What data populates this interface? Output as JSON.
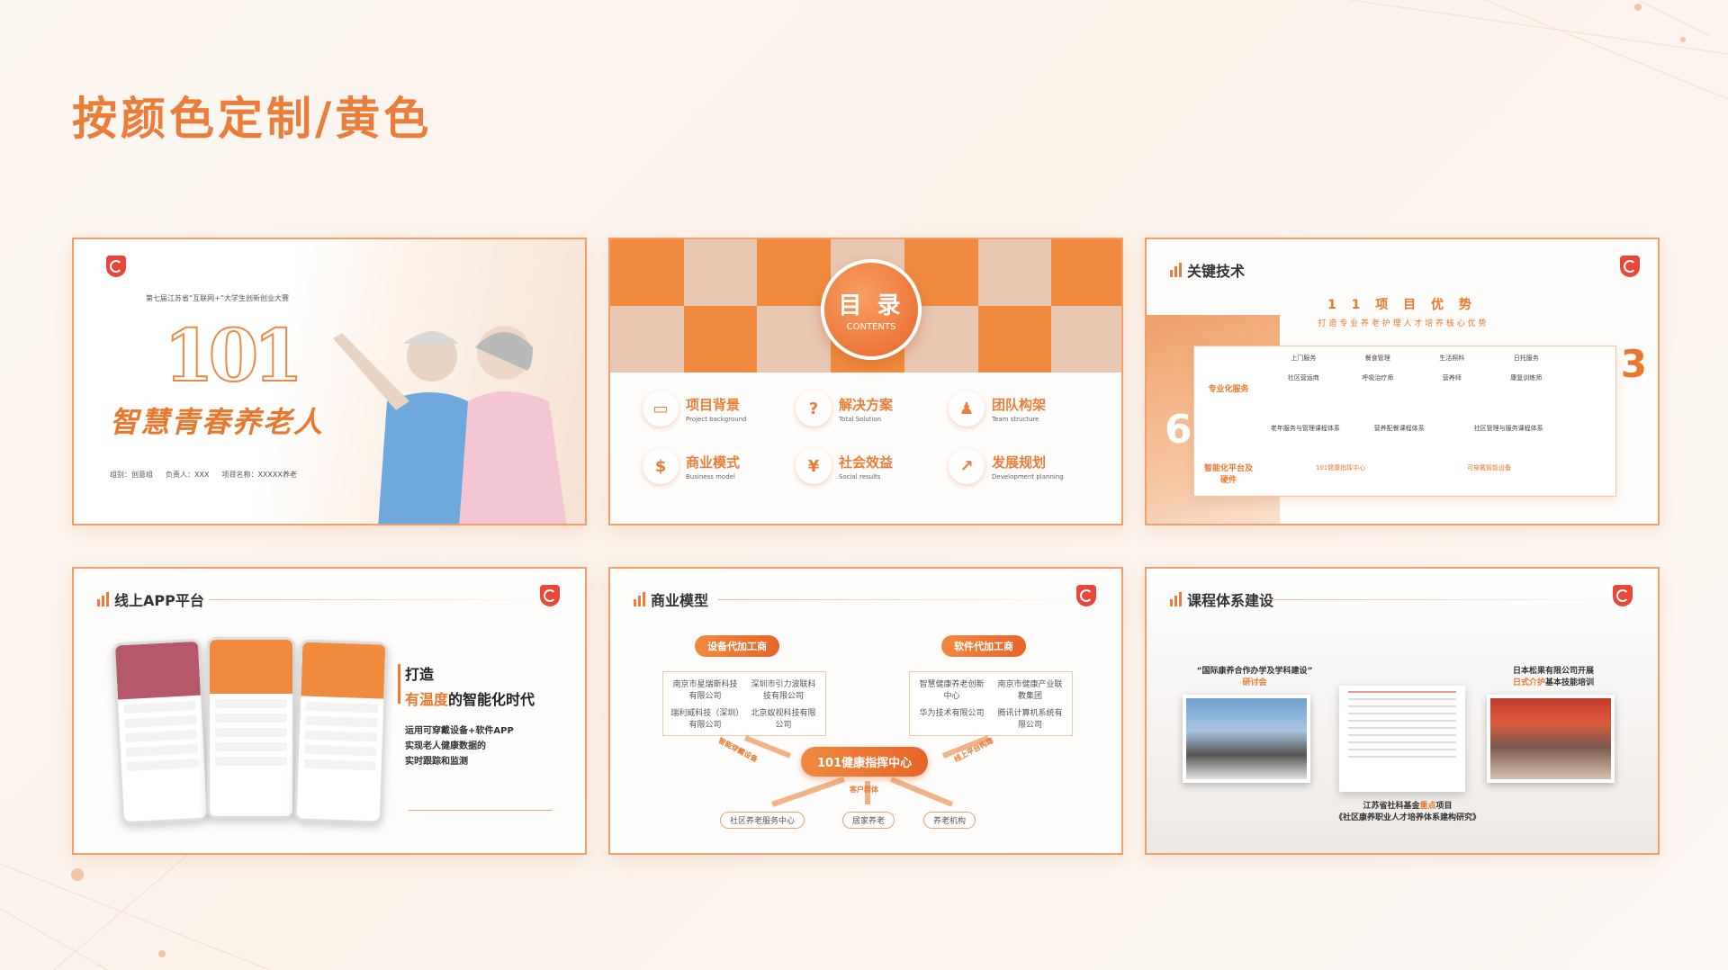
{
  "page": {
    "title": "按颜色定制/黄色"
  },
  "colors": {
    "accent": "#ea7d3a",
    "accent_dark": "#e8642a",
    "background": "#fbf2ea",
    "logo_red": "#e8473a"
  },
  "slide1": {
    "competition": "第七届江苏省“互联网+”大学生创新创业大赛",
    "number": "101",
    "title": "智慧青春养老人",
    "info": [
      "组别：创意组",
      "负责人：XXX",
      "项目名称：XXXXX养老"
    ]
  },
  "slide2": {
    "heading": "目 录",
    "heading_en": "CONTENTS",
    "items": [
      {
        "label": "项目背景",
        "en": "Project background",
        "icon": "monitor-icon"
      },
      {
        "label": "解决方案",
        "en": "Total Solution",
        "icon": "lightbulb-icon"
      },
      {
        "label": "团队构架",
        "en": "Team structure",
        "icon": "team-icon"
      },
      {
        "label": "商业模式",
        "en": "Business model",
        "icon": "dollar-icon"
      },
      {
        "label": "社会效益",
        "en": "Social results",
        "icon": "money-bag-icon"
      },
      {
        "label": "发展规划",
        "en": "Development planning",
        "icon": "chart-icon"
      }
    ]
  },
  "slide3": {
    "section": "关键技术",
    "advantage": "1 1 项 目 优 势",
    "subtitle": "打 造 专 业 养 老 护 理 人 才 培 养 核 心 优 势",
    "six": "6",
    "three": "3",
    "row1_label": "专业化服务",
    "row2_label": "智能化平台及硬件",
    "cells_top": [
      "上门服务",
      "餐食管理",
      "生活照料",
      "日托服务",
      "社区营运商",
      "呼吸治疗师",
      "营养师",
      "康复训练师"
    ],
    "cell_long1": "老年服务与管理课程体系",
    "cell_long2": "营养配餐课程体系",
    "cell_long3": "社区管理与服务课程体系",
    "hw1": "101健康指挥中心",
    "hw2": "可穿戴智能设备"
  },
  "slide4": {
    "section": "线上APP平台",
    "line1": "打造",
    "line2_hl": "有温度",
    "line2_rest": "的智能化时代",
    "desc": [
      "运用可穿戴设备+软件APP",
      "实现老人健康数据的",
      "实时跟踪和监测"
    ]
  },
  "slide5": {
    "section": "商业模型",
    "left_pill": "设备代加工商",
    "right_pill": "软件代加工商",
    "left_box": [
      "南京市星瑞斯科技有限公司",
      "深圳市引力波联科技有限公司",
      "瑞利威科技（深圳）有限公司",
      "北京蚁视科技有限公司"
    ],
    "right_box": [
      "智慧健康养老创新中心",
      "南京市健康产业联教集团",
      "华为技术有限公司",
      "腾讯计算机系统有限公司"
    ],
    "center": "101健康指挥中心",
    "left_arrow_label": "智能穿戴设备",
    "right_arrow_label": "线上平台构建",
    "bottom_label": "客户群体",
    "bottom": [
      "社区养老服务中心",
      "居家养老",
      "养老机构"
    ]
  },
  "slide6": {
    "section": "课程体系建设",
    "caption_left": "“国际康养合作办学及学科建设”",
    "caption_left_hl": "研讨会",
    "caption_right": "日本松果有限公司开展",
    "caption_right2_hl": "日式介护",
    "caption_right2_rest": "基本技能培训",
    "caption_bottom1_a": "江苏省社科基金",
    "caption_bottom1_hl": "重点",
    "caption_bottom1_b": "项目",
    "caption_bottom2": "《社区康养职业人才培养体系建构研究》"
  }
}
